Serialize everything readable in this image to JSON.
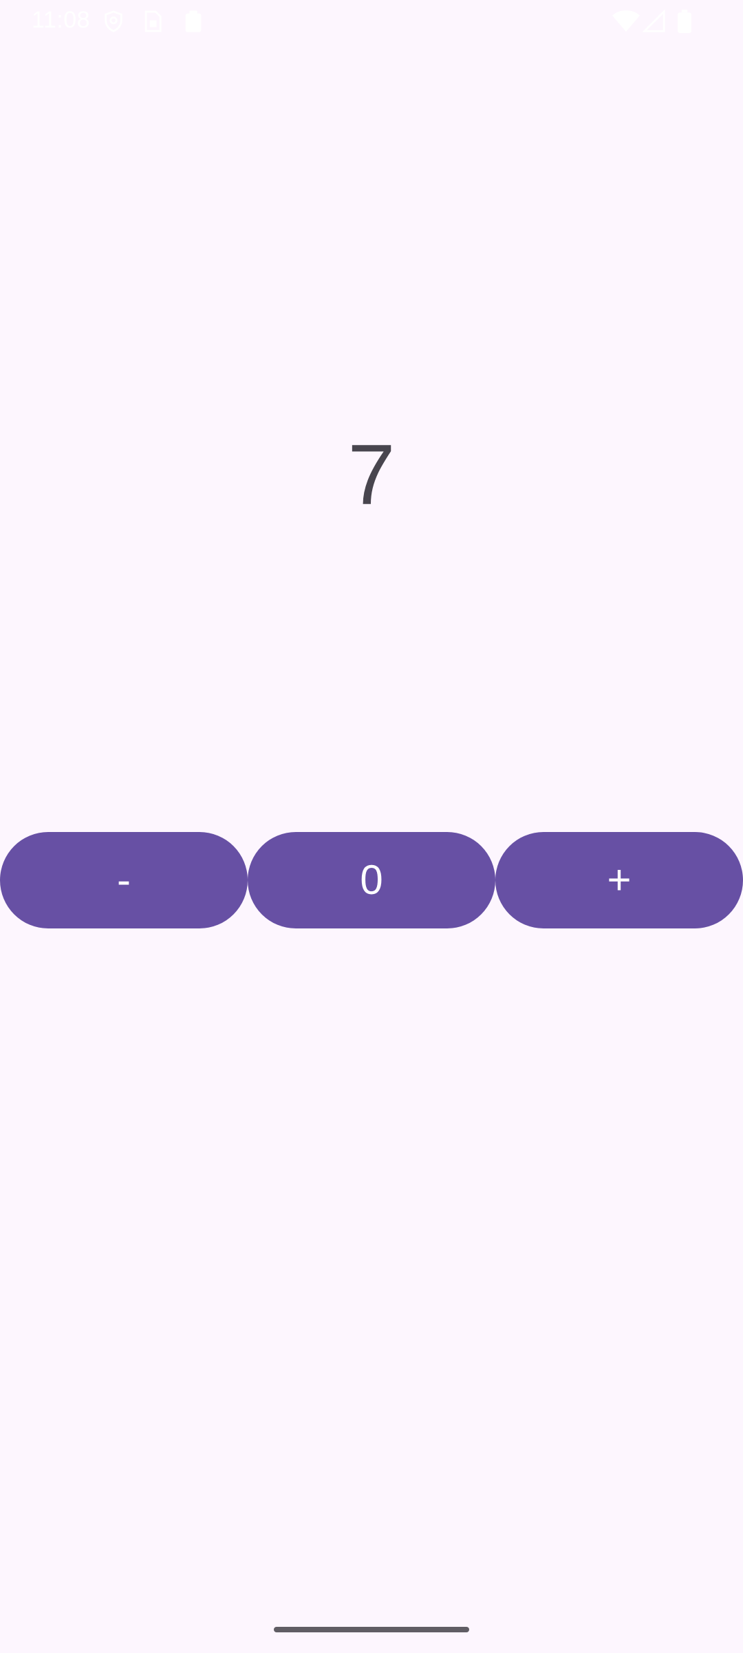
{
  "status_bar": {
    "time": "11:08",
    "icons": [
      "location-shield-icon",
      "sim-card-icon",
      "clipboard-icon",
      "wifi-icon",
      "cell-signal-icon",
      "battery-icon"
    ]
  },
  "counter": {
    "value": "7"
  },
  "buttons": {
    "decrement_label": "-",
    "reset_label": "0",
    "increment_label": "+"
  },
  "colors": {
    "background": "#FDF6FE",
    "button": "#6750A4",
    "button_text": "#FFFFFF",
    "counter_text": "#48454E",
    "nav_handle": "#605D64"
  }
}
